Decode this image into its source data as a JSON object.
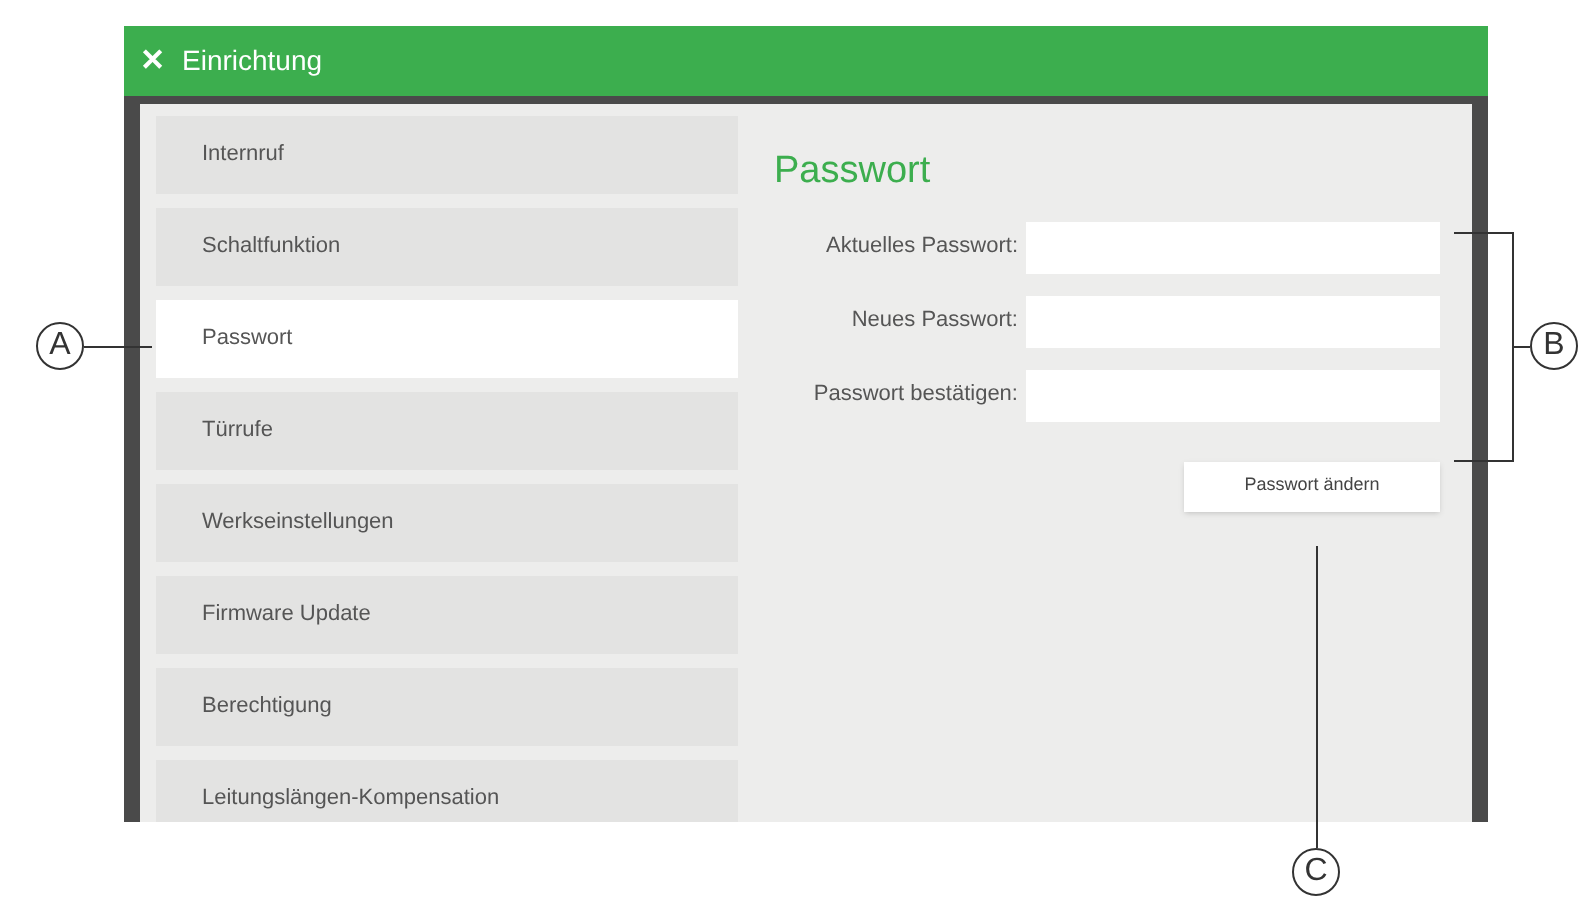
{
  "window": {
    "title": "Einrichtung",
    "close_icon": "✕"
  },
  "sidebar": {
    "items": [
      {
        "label": "Internruf",
        "selected": false
      },
      {
        "label": "Schaltfunktion",
        "selected": false
      },
      {
        "label": "Passwort",
        "selected": true
      },
      {
        "label": "Türrufe",
        "selected": false
      },
      {
        "label": "Werkseinstellungen",
        "selected": false
      },
      {
        "label": "Firmware Update",
        "selected": false
      },
      {
        "label": "Berechtigung",
        "selected": false
      },
      {
        "label": "Leitungslängen-Kompensation",
        "selected": false
      }
    ]
  },
  "panel": {
    "heading": "Passwort",
    "fields": [
      {
        "label": "Aktuelles Passwort:"
      },
      {
        "label": "Neues Passwort:"
      },
      {
        "label": "Passwort bestätigen:"
      }
    ],
    "button": "Passwort ändern"
  },
  "callouts": [
    {
      "letter": "A"
    },
    {
      "letter": "B"
    },
    {
      "letter": "C"
    }
  ]
}
